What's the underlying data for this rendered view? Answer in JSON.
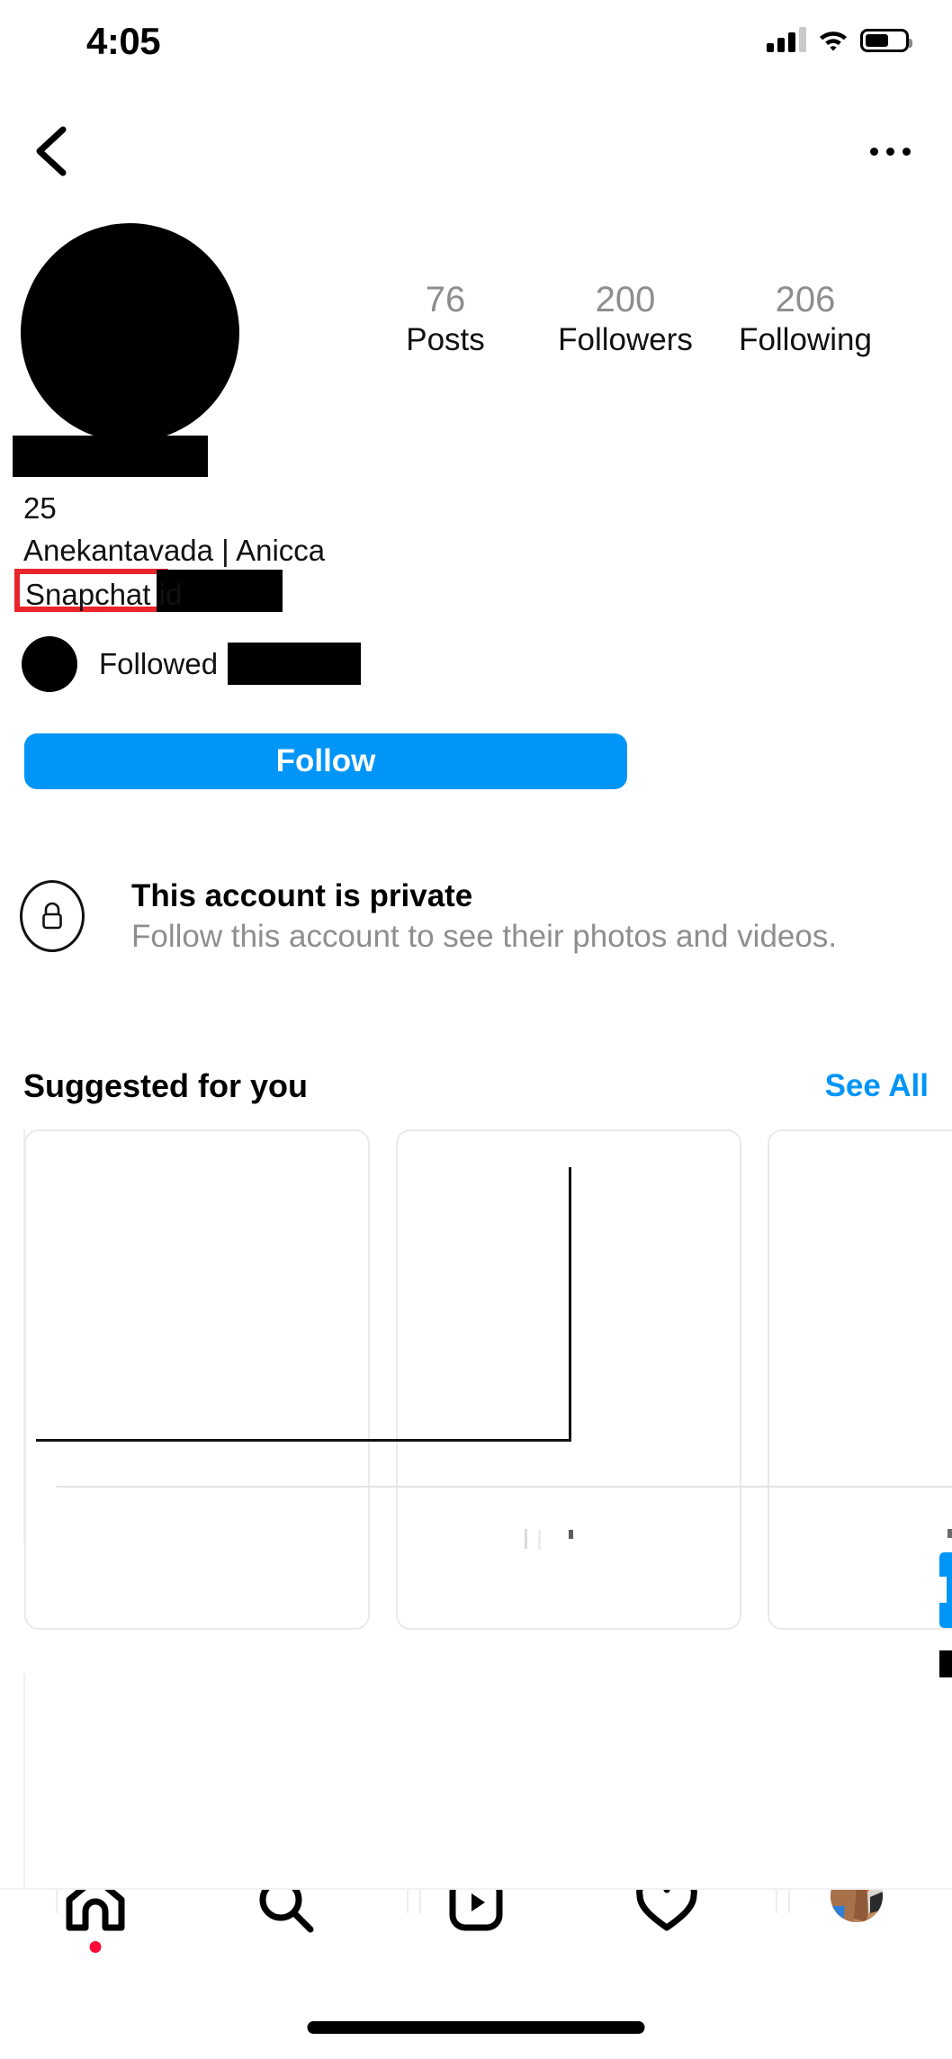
{
  "status_bar": {
    "time": "4:05",
    "cellular_icon": "cellular-signal-icon",
    "wifi_icon": "wifi-icon",
    "battery_icon": "battery-icon",
    "battery_level_pct": 60,
    "signal_bars_filled": 3,
    "signal_bars_total": 4
  },
  "top_nav": {
    "back_icon": "back-chevron-icon",
    "menu_icon": "more-options-icon"
  },
  "profile": {
    "avatar": "redacted-profile-photo",
    "display_name": "redacted-name",
    "stats": [
      {
        "value": "76",
        "label": "Posts"
      },
      {
        "value": "200",
        "label": "Followers"
      },
      {
        "value": "206",
        "label": "Following"
      }
    ],
    "bio": {
      "line1": "25",
      "line2": "Anekantavada | Anicca",
      "snapchat_label": "Snapchat id",
      "snapchat_value": "redacted-snapchat-id",
      "highlight_color": "#e8252a"
    },
    "followed_by": {
      "avatar": "redacted-follower-avatar",
      "text": "Followed by",
      "username": "redacted-username"
    },
    "follow_button": {
      "label": "Follow",
      "color": "#0095f6"
    }
  },
  "private_notice": {
    "lock_icon": "lock-icon",
    "title": "This account is private",
    "subtitle": "Follow this account to see their photos and videos."
  },
  "suggested": {
    "title": "Suggested for you",
    "see_all_label": "See All",
    "see_all_color": "#0095f6",
    "cards": [
      {
        "id": "card-1",
        "state": "empty"
      },
      {
        "id": "card-2",
        "state": "empty"
      },
      {
        "id": "card-3",
        "state": "empty"
      }
    ]
  },
  "tabbar": {
    "items": [
      {
        "icon": "home-icon",
        "badge": true
      },
      {
        "icon": "search-icon",
        "badge": false
      },
      {
        "icon": "reels-icon",
        "badge": false
      },
      {
        "icon": "activity-heart-icon",
        "badge": false
      },
      {
        "icon": "profile-avatar-icon",
        "badge": false
      }
    ],
    "badge_color": "#ff0a38",
    "home_indicator": "home-indicator"
  }
}
